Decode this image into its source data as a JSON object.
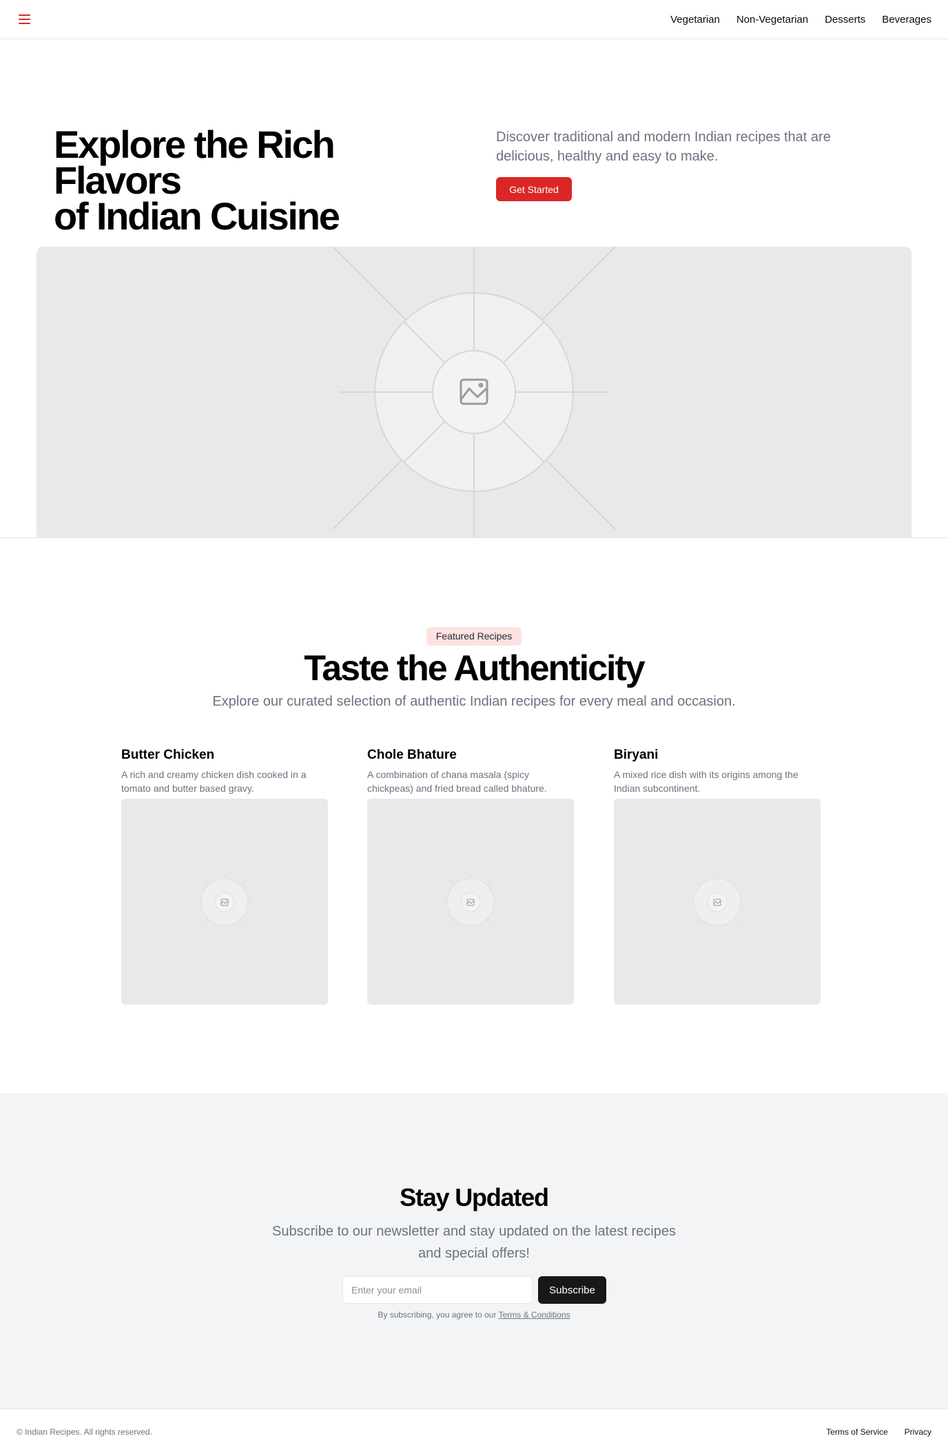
{
  "header": {
    "menu_icon": "hamburger-menu-icon",
    "nav": [
      "Vegetarian",
      "Non-Vegetarian",
      "Desserts",
      "Beverages"
    ]
  },
  "hero": {
    "title_line1": "Explore the Rich Flavors",
    "title_line2": "of Indian Cuisine",
    "description": "Discover traditional and modern Indian recipes that are delicious, healthy and easy to make.",
    "cta_label": "Get Started",
    "image_icon": "image-placeholder-icon"
  },
  "featured": {
    "badge": "Featured Recipes",
    "title": "Taste the Authenticity",
    "subtitle": "Explore our curated selection of authentic Indian recipes for every meal and occasion.",
    "cards": [
      {
        "title": "Butter Chicken",
        "description": "A rich and creamy chicken dish cooked in a tomato and butter based gravy."
      },
      {
        "title": "Chole Bhature",
        "description": "A combination of chana masala (spicy chickpeas) and fried bread called bhature."
      },
      {
        "title": "Biryani",
        "description": "A mixed rice dish with its origins among the Indian subcontinent."
      }
    ]
  },
  "newsletter": {
    "title": "Stay Updated",
    "subtitle": "Subscribe to our newsletter and stay updated on the latest recipes and special offers!",
    "email_placeholder": "Enter your email",
    "subscribe_label": "Subscribe",
    "terms_prefix": "By subscribing, you agree to our ",
    "terms_link": "Terms & Conditions"
  },
  "footer": {
    "copyright": "© Indian Recipes. All rights reserved.",
    "links": [
      "Terms of Service",
      "Privacy"
    ]
  },
  "colors": {
    "accent": "#dc2626",
    "badge_bg": "#fde2e2",
    "dark_button": "#18181b",
    "muted_text": "#6b7280",
    "placeholder_bg": "#e9e9e9"
  }
}
